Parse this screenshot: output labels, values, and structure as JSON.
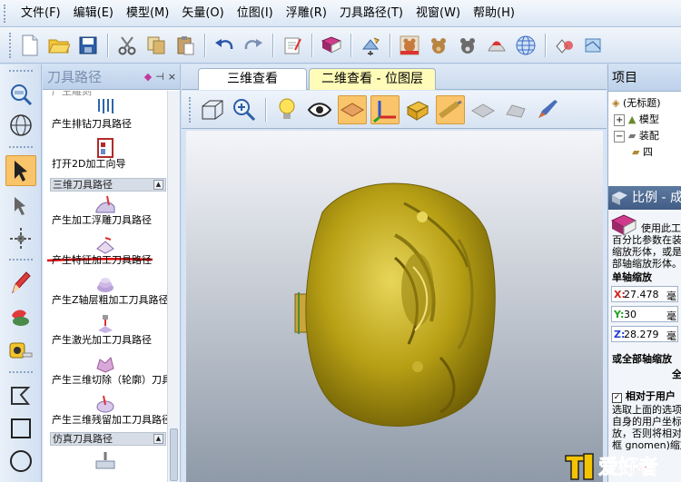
{
  "menu": [
    "文件(F)",
    "编辑(E)",
    "模型(M)",
    "矢量(O)",
    "位图(I)",
    "浮雕(R)",
    "刀具路径(T)",
    "视窗(W)",
    "帮助(H)"
  ],
  "toolpath_panel": {
    "title": "刀具路径",
    "items": [
      {
        "label": "产生排钻刀具路径",
        "icon": "drill-icon"
      },
      {
        "label": "打开2D加工向导",
        "icon": "wizard-icon"
      },
      {
        "label": "产生加工浮雕刀具路径",
        "icon": "relief-toolpath-icon"
      },
      {
        "label": "产生特征加工刀具路径",
        "icon": "feature-toolpath-icon"
      },
      {
        "label": "产生Z轴层粗加工刀具路径",
        "icon": "z-level-roughing-icon"
      },
      {
        "label": "产生激光加工刀具路径",
        "icon": "laser-toolpath-icon"
      },
      {
        "label": "产生三维切除（轮廓）刀具",
        "icon": "3d-cutout-icon"
      },
      {
        "label": "产生三维残留加工刀具路径",
        "icon": "3d-rest-machining-icon"
      }
    ],
    "sections": [
      "三维刀具路径",
      "仿真刀具路径"
    ],
    "partial_top_label": "产生雕刻"
  },
  "view_tabs": [
    "三维查看",
    "二维查看 - 位图层"
  ],
  "project_panel": {
    "title": "项目",
    "tree": [
      "(无标题)",
      "模型",
      "装配",
      "四"
    ]
  },
  "scale_panel": {
    "title": "比例 - 成",
    "desc_lines": [
      "使用此工",
      "百分比参数在装",
      "缩放形体，或是",
      "部轴缩放形体。"
    ],
    "single_axis_label": "单轴缩放",
    "x_value": "27.478",
    "y_value": "30",
    "z_value": "28.279",
    "field_suffix": "毫",
    "all_axis_label": "或全部轴缩放",
    "all_axis_value": "全",
    "relative_checkbox_label": "相对于用户",
    "relative_checked": true,
    "more_lines": [
      "选取上面的选项",
      "自身的用户坐标",
      "放，否则将相对",
      "框 gnomen)缩放"
    ]
  },
  "watermark": "爱好者"
}
